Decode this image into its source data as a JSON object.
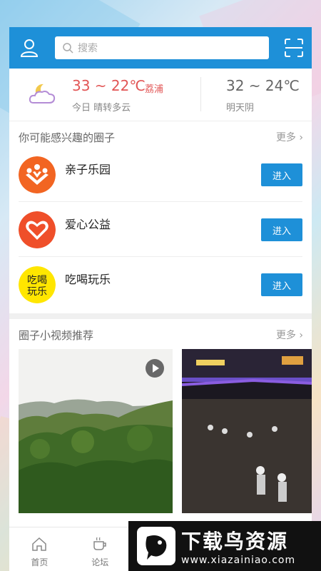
{
  "search": {
    "placeholder": "搜索"
  },
  "weather": {
    "today_temp": "33 ~ 22℃",
    "city": "荔浦",
    "today_desc": "今日 晴转多云",
    "tomorrow_temp": "32 ~ 24℃",
    "tomorrow_desc": "明天阴"
  },
  "circles_section": {
    "title": "你可能感兴趣的圈子",
    "more": "更多"
  },
  "circles": [
    {
      "name": "亲子乐园",
      "button": "进入"
    },
    {
      "name": "爱心公益",
      "button": "进入"
    },
    {
      "name": "吃喝玩乐",
      "button": "进入"
    }
  ],
  "logo3_text": "吃喝玩乐",
  "video_section": {
    "title": "圈子小视频推荐",
    "more": "更多"
  },
  "tabs": [
    {
      "label": "首页",
      "icon": "home-icon"
    },
    {
      "label": "论坛",
      "icon": "coffee-icon"
    },
    {
      "label": "",
      "icon": "video-icon"
    },
    {
      "label": "",
      "icon": "circle-icon"
    },
    {
      "label": "",
      "icon": "message-icon"
    }
  ],
  "watermark": {
    "title": "下载鸟资源",
    "url": "www.xiazainiao.com"
  },
  "colors": {
    "primary": "#1e90d8",
    "temp": "#e25555"
  }
}
